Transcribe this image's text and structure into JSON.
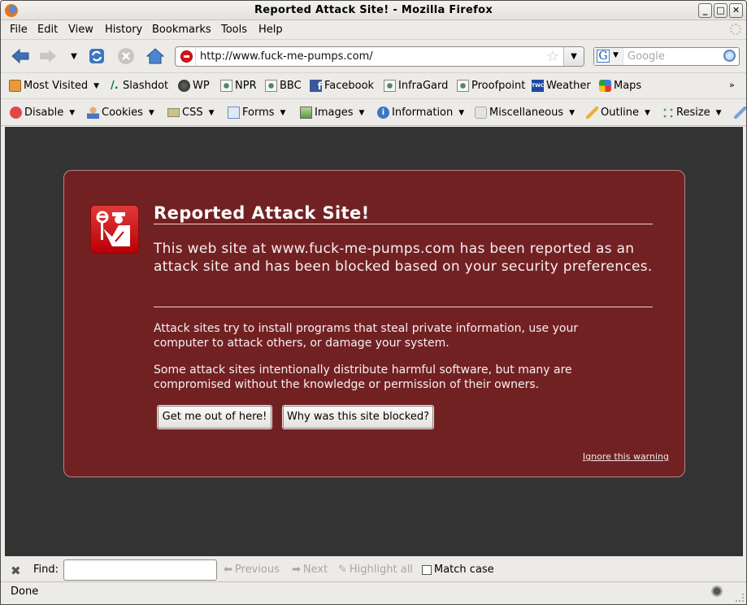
{
  "window": {
    "title": "Reported Attack Site! - Mozilla Firefox",
    "controls": {
      "minimize": "_",
      "maximize": "□",
      "close": "✕"
    }
  },
  "menubar": {
    "items": [
      {
        "label": "File",
        "accesskey": "F"
      },
      {
        "label": "Edit",
        "accesskey": "E"
      },
      {
        "label": "View",
        "accesskey": "V"
      },
      {
        "label": "History",
        "accesskey": "s"
      },
      {
        "label": "Bookmarks",
        "accesskey": "B"
      },
      {
        "label": "Tools",
        "accesskey": "T"
      },
      {
        "label": "Help",
        "accesskey": "H"
      }
    ]
  },
  "navbar": {
    "url": "http://www.fuck-me-pumps.com/",
    "search_engine": "G",
    "search_placeholder": "Google"
  },
  "bookmarks": {
    "items": [
      "Most Visited",
      "Slashdot",
      "WP",
      "NPR",
      "BBC",
      "Facebook",
      "InfraGard",
      "Proofpoint",
      "Weather",
      "Maps"
    ],
    "overflow": "»"
  },
  "webdev_toolbar": {
    "items": [
      "Disable",
      "Cookies",
      "CSS",
      "Forms",
      "Images",
      "Information",
      "Miscellaneous",
      "Outline",
      "Resize"
    ]
  },
  "error_page": {
    "title": "Reported Attack Site!",
    "short_desc": "This web site at www.fuck-me-pumps.com has been reported as an attack site and has been blocked based on your security preferences.",
    "long_desc_1": "Attack sites try to install programs that steal private information, use your computer to attack others, or damage your system.",
    "long_desc_2": "Some attack sites intentionally distribute harmful software, but many are compromised without the knowledge or permission of their owners.",
    "button_get_out": "Get me out of here!",
    "button_why_blocked": "Why was this site blocked?",
    "ignore_link": "Ignore this warning",
    "colors": {
      "background": "#722123",
      "page": "#333333"
    }
  },
  "findbar": {
    "label": "Find:",
    "value": "",
    "previous": "Previous",
    "next": "Next",
    "highlight_all": "Highlight all",
    "match_case": "Match case",
    "match_case_checked": false
  },
  "statusbar": {
    "status": "Done"
  }
}
